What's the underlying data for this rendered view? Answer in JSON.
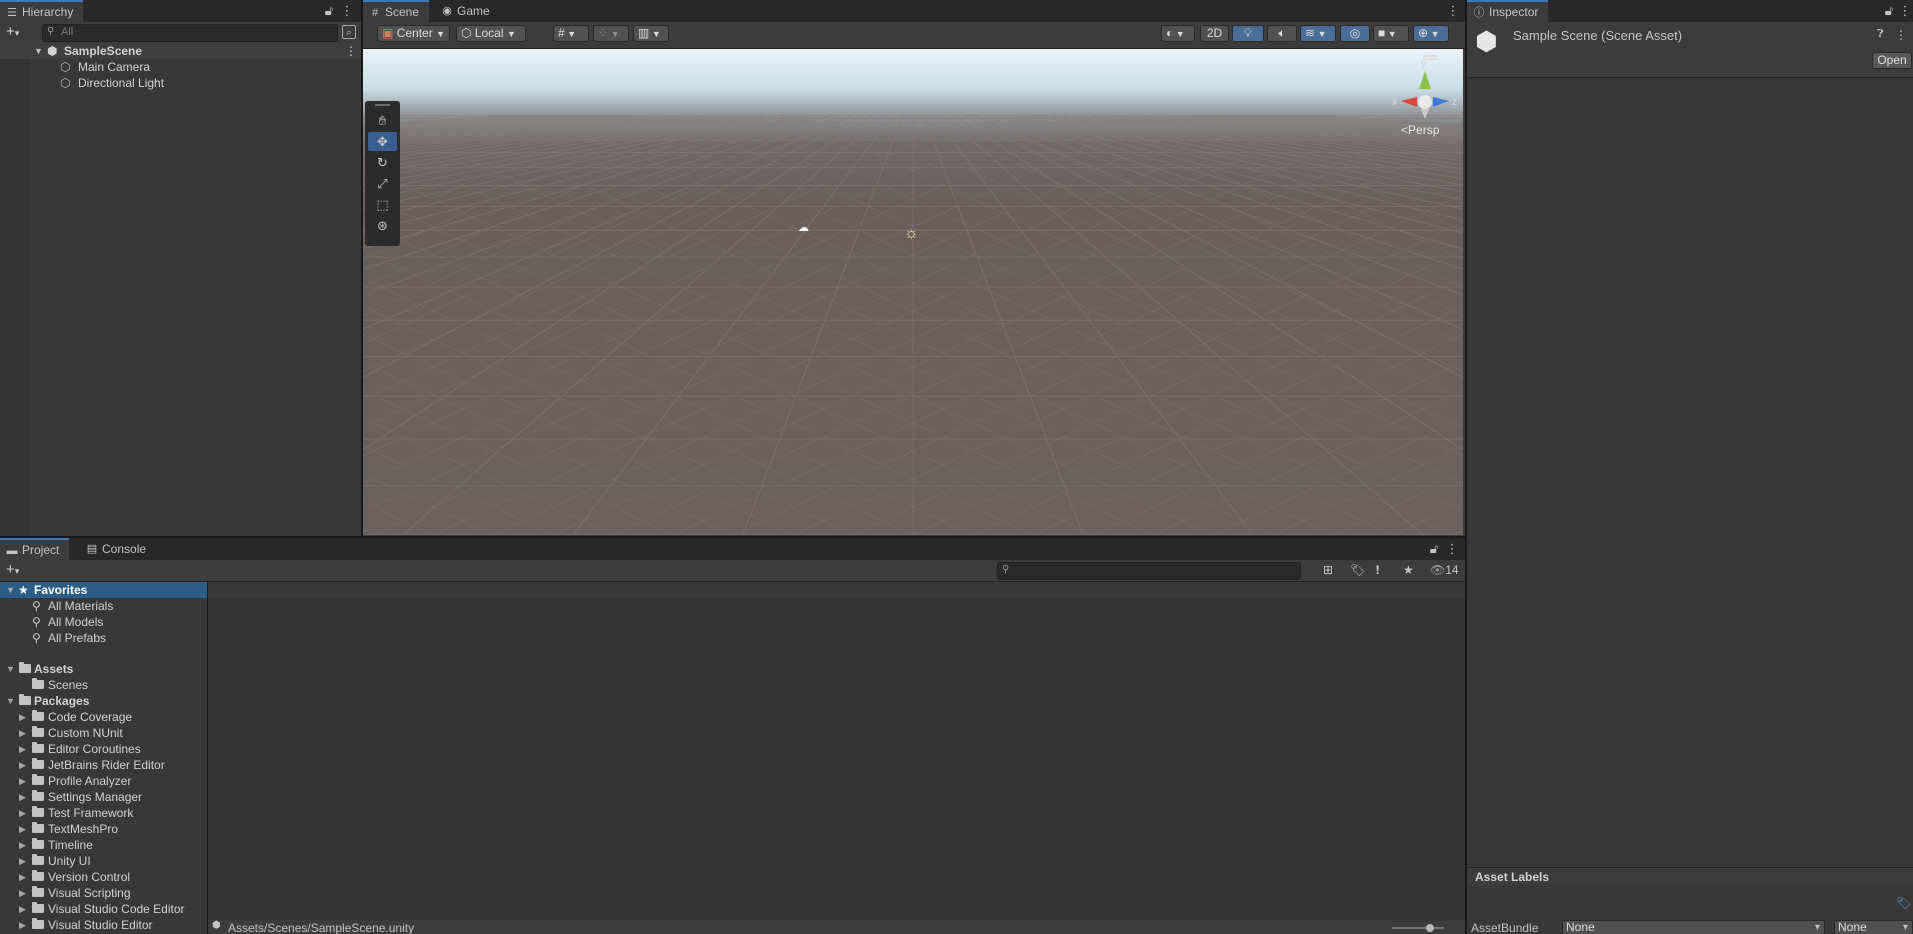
{
  "hierarchy": {
    "tab": "Hierarchy",
    "search_placeholder": "All",
    "scene_name": "SampleScene",
    "items": [
      "Main Camera",
      "Directional Light"
    ]
  },
  "scene": {
    "tabs": [
      "Scene",
      "Game"
    ],
    "pivot_label": "Center",
    "space_label": "Local",
    "mode_2d_label": "2D",
    "projection_label": "Persp",
    "gizmo_axes": {
      "x": "x",
      "y": "y",
      "z": "z"
    }
  },
  "inspector": {
    "tab": "Inspector",
    "asset_title": "Sample Scene (Scene Asset)",
    "open_button": "Open",
    "asset_labels_header": "Asset Labels",
    "asset_bundle_label": "AssetBundle",
    "asset_bundle_value": "None",
    "asset_bundle_variant": "None"
  },
  "project": {
    "tabs": [
      "Project",
      "Console"
    ],
    "visible_count": "14",
    "favorites_label": "Favorites",
    "favorites": [
      "All Materials",
      "All Models",
      "All Prefabs"
    ],
    "assets_label": "Assets",
    "assets": [
      "Scenes"
    ],
    "packages_label": "Packages",
    "packages": [
      "Code Coverage",
      "Custom NUnit",
      "Editor Coroutines",
      "JetBrains Rider Editor",
      "Profile Analyzer",
      "Settings Manager",
      "Test Framework",
      "TextMeshPro",
      "Timeline",
      "Unity UI",
      "Version Control",
      "Visual Scripting",
      "Visual Studio Code Editor",
      "Visual Studio Editor"
    ],
    "status_path": "Assets/Scenes/SampleScene.unity"
  },
  "colors": {
    "accent": "#3a79bb",
    "selection": "#2c5d87",
    "panel": "#383838"
  }
}
